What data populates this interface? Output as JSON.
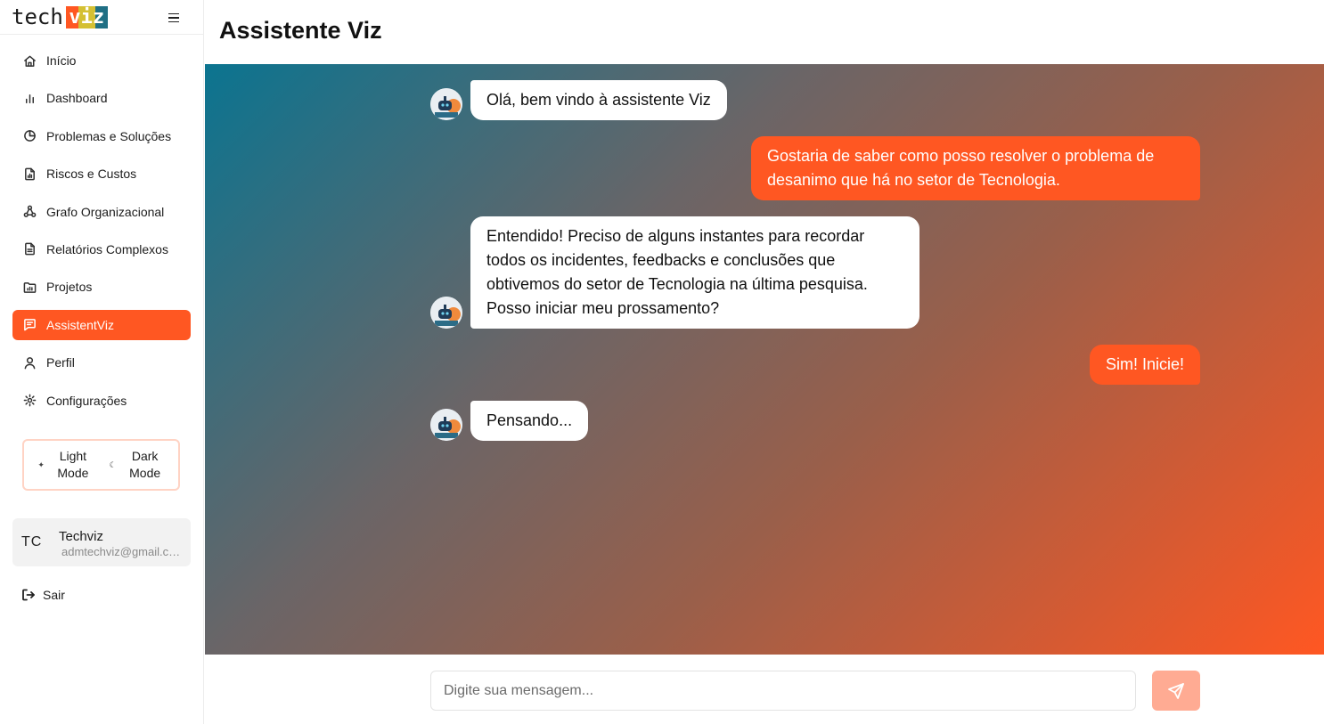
{
  "brand": {
    "text": "tech",
    "accent": "viz"
  },
  "sidebar": {
    "items": [
      {
        "label": "Início",
        "icon": "home-icon"
      },
      {
        "label": "Dashboard",
        "icon": "bar-chart-icon"
      },
      {
        "label": "Problemas e Soluções",
        "icon": "pie-chart-icon"
      },
      {
        "label": "Riscos e Custos",
        "icon": "file-chart-icon"
      },
      {
        "label": "Grafo Organizacional",
        "icon": "network-icon"
      },
      {
        "label": "Relatórios Complexos",
        "icon": "document-icon"
      },
      {
        "label": "Projetos",
        "icon": "folder-chart-icon"
      },
      {
        "label": "AssistentViz",
        "icon": "chat-icon",
        "active": true
      },
      {
        "label": "Perfil",
        "icon": "user-icon"
      },
      {
        "label": "Configurações",
        "icon": "gear-icon"
      }
    ],
    "mode": {
      "light_label": "Light Mode",
      "dark_label": "Dark Mode"
    },
    "user": {
      "initials": "TC",
      "name": "Techviz",
      "email": "admtechviz@gmail.com"
    },
    "logout_label": "Sair"
  },
  "main": {
    "title": "Assistente Viz",
    "messages": [
      {
        "from": "bot",
        "text": "Olá, bem vindo à assistente Viz"
      },
      {
        "from": "user",
        "text": "Gostaria de saber como posso resolver o problema de desanimo que há no setor de Tecnologia."
      },
      {
        "from": "bot",
        "text": "Entendido! Preciso de alguns instantes para recordar todos os incidentes, feedbacks e conclusões que obtivemos do setor de Tecnologia na última pesquisa. Posso iniciar meu prossamento?"
      },
      {
        "from": "user",
        "text": "Sim! Inicie!"
      },
      {
        "from": "bot",
        "text": "Pensando..."
      }
    ],
    "composer": {
      "placeholder": "Digite sua mensagem..."
    }
  },
  "colors": {
    "accent": "#ff5722",
    "accent_light": "#ffab93",
    "teal": "#0b7490"
  }
}
